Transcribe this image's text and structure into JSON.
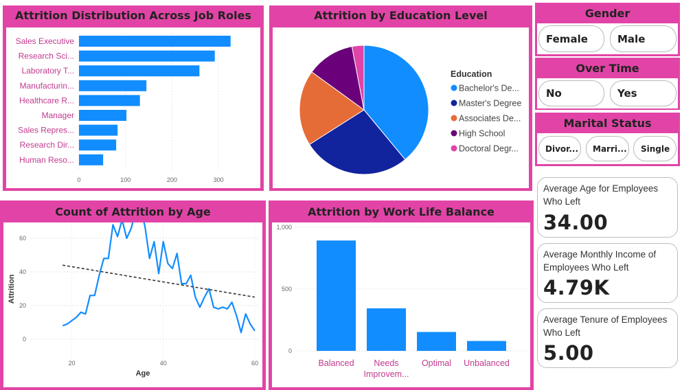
{
  "job_roles": {
    "title": "Attrition Distribution Across Job Roles",
    "chart_data": {
      "type": "bar",
      "orientation": "horizontal",
      "categories": [
        "Sales Executive",
        "Research Sci...",
        "Laboratory T...",
        "Manufacturin...",
        "Healthcare R...",
        "Manager",
        "Sales Repres...",
        "Research Dir...",
        "Human Reso..."
      ],
      "values": [
        326,
        292,
        259,
        145,
        131,
        102,
        83,
        80,
        52
      ],
      "xticks": [
        "0",
        "100",
        "200",
        "300"
      ],
      "xlim": [
        0,
        350
      ],
      "bar_color": "#118dff"
    }
  },
  "education": {
    "title": "Attrition by Education Level",
    "chart_data": {
      "type": "pie",
      "legend_title": "Education",
      "legend_position": "right",
      "slices": [
        {
          "label": "Bachelor's De...",
          "value": 39,
          "color": "#118dff"
        },
        {
          "label": "Master's Degree",
          "value": 27,
          "color": "#12239e"
        },
        {
          "label": "Associates De...",
          "value": 19,
          "color": "#e66c37"
        },
        {
          "label": "High School",
          "value": 12,
          "color": "#6b007b"
        },
        {
          "label": "Doctoral Degr...",
          "value": 3,
          "color": "#e044a7"
        }
      ]
    }
  },
  "slicers": {
    "gender": {
      "title": "Gender",
      "options": [
        "Female",
        "Male"
      ]
    },
    "overtime": {
      "title": "Over Time",
      "options": [
        "No",
        "Yes"
      ]
    },
    "marital": {
      "title": "Marital Status",
      "options": [
        "Divor...",
        "Marri...",
        "Single"
      ]
    }
  },
  "age_chart": {
    "title": "Count of Attrition by Age",
    "chart_data": {
      "type": "line",
      "xlabel": "Age",
      "ylabel": "Attrition",
      "xlim": [
        18,
        60
      ],
      "ylim": [
        0,
        80
      ],
      "xticks": [
        "20",
        "40",
        "60"
      ],
      "yticks": [
        "0",
        "20",
        "40",
        "60",
        "80"
      ],
      "x": [
        18,
        19,
        20,
        21,
        22,
        23,
        24,
        25,
        26,
        27,
        28,
        29,
        30,
        31,
        32,
        33,
        34,
        35,
        36,
        37,
        38,
        39,
        40,
        41,
        42,
        43,
        44,
        45,
        46,
        47,
        48,
        49,
        50,
        51,
        52,
        53,
        54,
        55,
        56,
        57,
        58,
        59,
        60
      ],
      "y": [
        8,
        9,
        11,
        13,
        16,
        15,
        26,
        26,
        38,
        48,
        48,
        68,
        61,
        71,
        60,
        66,
        77,
        78,
        67,
        48,
        58,
        39,
        58,
        45,
        42,
        51,
        33,
        33,
        38,
        25,
        19,
        25,
        30,
        19,
        18,
        19,
        18,
        22,
        14,
        4,
        15,
        9,
        5
      ],
      "trend": {
        "x": [
          18,
          60
        ],
        "y": [
          44,
          25
        ]
      },
      "line_color": "#118dff"
    }
  },
  "wlb": {
    "title": "Attrition by Work Life Balance",
    "chart_data": {
      "type": "bar",
      "categories": [
        "Balanced",
        "Needs Improvem...",
        "Optimal",
        "Unbalanced"
      ],
      "values": [
        893,
        344,
        153,
        80
      ],
      "yticks": [
        "0",
        "500",
        "1,000"
      ],
      "ylim": [
        0,
        1000
      ],
      "bar_color": "#118dff"
    }
  },
  "cards": [
    {
      "label": "Average Age for Employees Who Left",
      "value": "34.00"
    },
    {
      "label": "Average Monthly Income of Employees Who Left",
      "value": "4.79K"
    },
    {
      "label": "Average Tenure of Employees Who Left",
      "value": "5.00"
    }
  ]
}
